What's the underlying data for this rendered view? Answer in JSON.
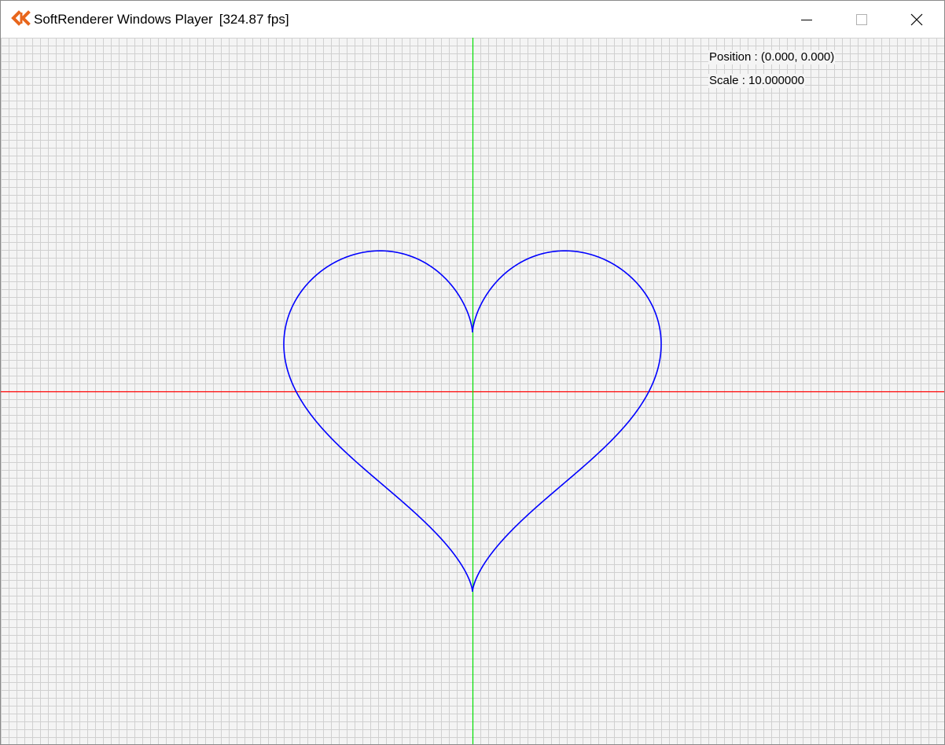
{
  "window": {
    "title": "SoftRenderer Windows Player",
    "fps": "[324.87 fps]",
    "icon": "ck-logo-icon",
    "accent": "#e8661c",
    "controls": [
      "minimize-icon",
      "maximize-icon",
      "close-icon"
    ]
  },
  "overlay": {
    "position_text": "Position : (0.000, 0.000)",
    "scale_text": "Scale : 10.000000"
  },
  "scene": {
    "background_color": "#f4f4f4",
    "grid_color": "#d0d0d0",
    "x_axis_color": "#ff0000",
    "y_axis_color": "#00e000",
    "curve_color": "#0000ff",
    "curve": "heart",
    "camera_position": [
      0,
      0
    ],
    "scale": 10
  }
}
